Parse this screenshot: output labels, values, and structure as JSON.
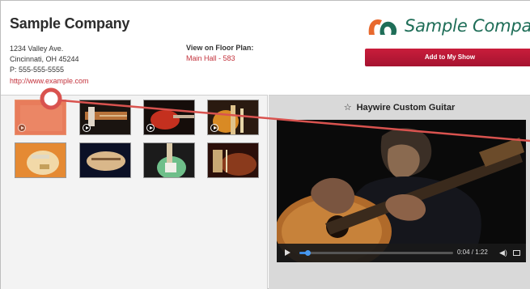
{
  "company": {
    "name": "Sample Company",
    "address_line1": "1234 Valley Ave.",
    "address_line2": "Cincinnati, OH 45244",
    "phone": "P: 555-555-5555",
    "website": "http://www.example.com"
  },
  "floor_plan": {
    "label": "View on Floor Plan:",
    "location": "Main Hall - 583"
  },
  "logo": {
    "text": "Sample Company"
  },
  "add_button": {
    "label": "Add to My Show"
  },
  "video": {
    "star": "☆",
    "title": "Haywire Custom Guitar",
    "time": "0:04 / 1:22",
    "progress": 0.05
  },
  "gallery": {
    "thumbnails": [
      {
        "name": "thumb-1",
        "has_play": true,
        "selected": true
      },
      {
        "name": "thumb-2",
        "has_play": true,
        "selected": false
      },
      {
        "name": "thumb-3",
        "has_play": true,
        "selected": false
      },
      {
        "name": "thumb-4",
        "has_play": true,
        "selected": false
      },
      {
        "name": "thumb-5",
        "has_play": false,
        "selected": false
      },
      {
        "name": "thumb-6",
        "has_play": false,
        "selected": false
      },
      {
        "name": "thumb-7",
        "has_play": false,
        "selected": false
      },
      {
        "name": "thumb-8",
        "has_play": false,
        "selected": false
      }
    ]
  },
  "colors": {
    "link": "#c3323c",
    "button": "#b8193a",
    "logo": "#1f6e58",
    "accent_orange": "#e8692e",
    "cursor_red": "#d9534f"
  }
}
